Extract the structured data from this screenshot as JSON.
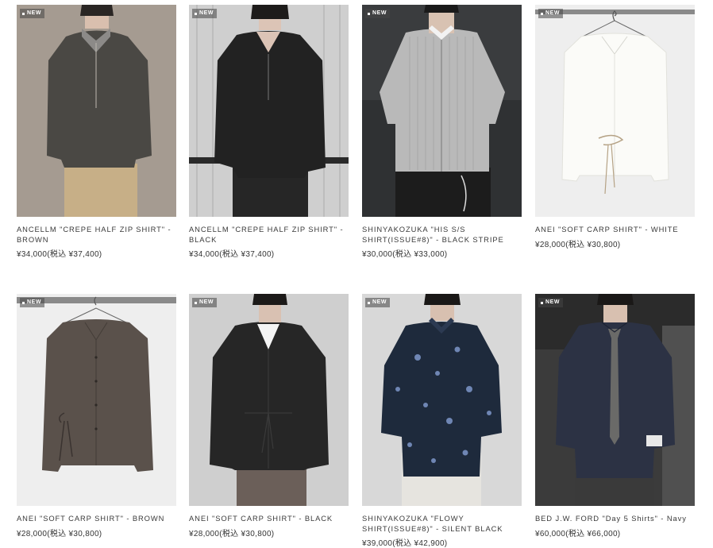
{
  "products": [
    {
      "name": "ANCELLM \"CREPE HALF ZIP SHIRT\" - BROWN",
      "price": "¥34,000(税込 ¥37,400)",
      "badge": "NEW",
      "image": "model-brown-half-zip-shirt",
      "colors": {
        "bg": "#a49a90",
        "garment": "#4b4945",
        "pants": "#c6ae86",
        "skin": "#d9bfae"
      }
    },
    {
      "name": "ANCELLM \"CREPE HALF ZIP SHIRT\" - BLACK",
      "price": "¥34,000(税込 ¥37,400)",
      "badge": "NEW",
      "image": "model-black-half-zip-shirt",
      "colors": {
        "bg": "#d5d5d5",
        "garment": "#242424",
        "pants": "#2a2a2a",
        "skin": "#ddc6b8"
      }
    },
    {
      "name": "SHINYAKOZUKA \"HIS S/S SHIRT(ISSUE#8)\" - BLACK STRIPE",
      "price": "¥30,000(税込 ¥33,000)",
      "badge": "NEW",
      "image": "model-striped-short-sleeve-shirt",
      "colors": {
        "bg": "#2e3032",
        "garment": "#b8b8b8",
        "pants": "#1c1c1c",
        "skin": "#d8c2b2"
      }
    },
    {
      "name": "ANEI \"SOFT CARP SHIRT\" - WHITE",
      "price": "¥28,000(税込 ¥30,800)",
      "badge": "NEW",
      "image": "hanging-white-shirt",
      "colors": {
        "bg": "#eeeeee",
        "garment": "#fbfbf8",
        "pants": "",
        "skin": ""
      }
    },
    {
      "name": "ANEI \"SOFT CARP SHIRT\" - BROWN",
      "price": "¥28,000(税込 ¥30,800)",
      "badge": "NEW",
      "image": "hanging-brown-shirt",
      "colors": {
        "bg": "#ededed",
        "garment": "#5a514b",
        "pants": "",
        "skin": ""
      }
    },
    {
      "name": "ANEI \"SOFT CARP SHIRT\" - BLACK",
      "price": "¥28,000(税込 ¥30,800)",
      "badge": "NEW",
      "image": "model-black-wrap-shirt",
      "colors": {
        "bg": "#cfcfcf",
        "garment": "#262626",
        "pants": "#6a5e58",
        "skin": "#d9c1b2"
      }
    },
    {
      "name": "SHINYAKOZUKA \"FLOWY SHIRT(ISSUE#8)\" - SILENT BLACK",
      "price": "¥39,000(税込 ¥42,900)",
      "badge": "NEW",
      "image": "model-floral-navy-shirt",
      "colors": {
        "bg": "#d8d8d8",
        "garment": "#1e2a3c",
        "pants": "#e6e4df",
        "skin": "#d8c0b0"
      }
    },
    {
      "name": "BED J.W. FORD \"Day 5 Shirts\" - Navy",
      "price": "¥60,000(税込 ¥66,000)",
      "badge": "NEW",
      "image": "model-navy-shirt-tie",
      "colors": {
        "bg": "#3a3a3a",
        "garment": "#2c3244",
        "pants": "#3a3a3a",
        "skin": "#d8c0b0"
      }
    }
  ]
}
